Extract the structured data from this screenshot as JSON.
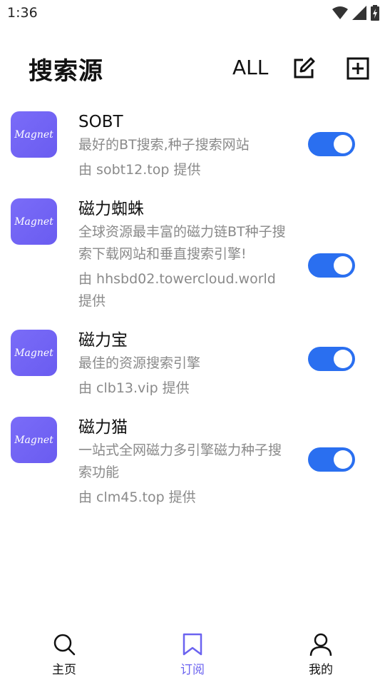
{
  "status": {
    "time": "1:36"
  },
  "header": {
    "title": "搜索源",
    "all_label": "ALL"
  },
  "sources": [
    {
      "name": "SOBT",
      "desc": "最好的BT搜索,种子搜索网站",
      "by": "由 sobt12.top 提供",
      "logo_text": "Magnet",
      "enabled": true
    },
    {
      "name": "磁力蜘蛛",
      "desc": "全球资源最丰富的磁力链BT种子搜索下载网站和垂直搜索引擎!",
      "by": "由 hhsbd02.towercloud.world 提供",
      "logo_text": "Magnet",
      "enabled": true
    },
    {
      "name": "磁力宝",
      "desc": "最佳的资源搜索引擎",
      "by": "由 clb13.vip 提供",
      "logo_text": "Magnet",
      "enabled": true
    },
    {
      "name": "磁力猫",
      "desc": "一站式全网磁力多引擎磁力种子搜索功能",
      "by": "由 clm45.top 提供",
      "logo_text": "Magnet",
      "enabled": true
    }
  ],
  "nav": [
    {
      "label": "主页",
      "icon": "search-icon"
    },
    {
      "label": "订阅",
      "icon": "bookmark-icon",
      "active": true
    },
    {
      "label": "我的",
      "icon": "user-icon"
    }
  ],
  "colors": {
    "accent": "#2a6ff0",
    "nav_active": "#6b63f0",
    "logo": "#7066f4"
  }
}
